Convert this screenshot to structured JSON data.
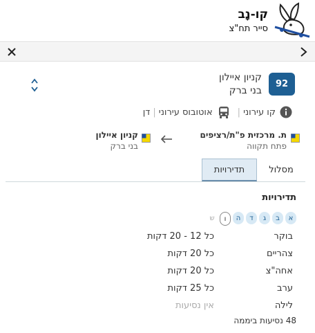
{
  "brand": {
    "title": "קו-נָב",
    "subtitle": "סייר תח\"צ"
  },
  "route": {
    "number": "92",
    "destination": "קניון איילון",
    "destination_city": "בני ברק"
  },
  "info": {
    "line_type": "קו עירוני",
    "vehicle_type": "אוטובוס עירוני",
    "operator": "דן"
  },
  "trip": {
    "from_name": "ת. מרכזית פ\"ת/רציפים",
    "from_city": "פתח תקווה",
    "to_name": "קניון איילון",
    "to_city": "בני ברק",
    "stop_colors": [
      "#f5d800",
      "#1f4fa0"
    ]
  },
  "tabs": {
    "route": "מסלול",
    "frequency": "תדירויות"
  },
  "frequency": {
    "title": "תדירויות",
    "days": [
      {
        "label": "א",
        "state": "on"
      },
      {
        "label": "ב",
        "state": "on"
      },
      {
        "label": "ג",
        "state": "on"
      },
      {
        "label": "ד",
        "state": "on"
      },
      {
        "label": "ה",
        "state": "on"
      },
      {
        "label": "ו",
        "state": "selected"
      },
      {
        "label": "ש",
        "state": "off"
      }
    ],
    "rows": [
      {
        "period": "בוקר",
        "value": "כל 12 - 20 דקות"
      },
      {
        "period": "צהריים",
        "value": "כל 20 דקות"
      },
      {
        "period": "אחה\"צ",
        "value": "כל 20 דקות"
      },
      {
        "period": "ערב",
        "value": "כל 25 דקות"
      },
      {
        "period": "לילה",
        "value": "אין נסיעות"
      }
    ],
    "daily_total": "48 נסיעות ביממה"
  },
  "colors": {
    "accent": "#1e5f93",
    "tab_active_bg": "#e0ebf4"
  }
}
